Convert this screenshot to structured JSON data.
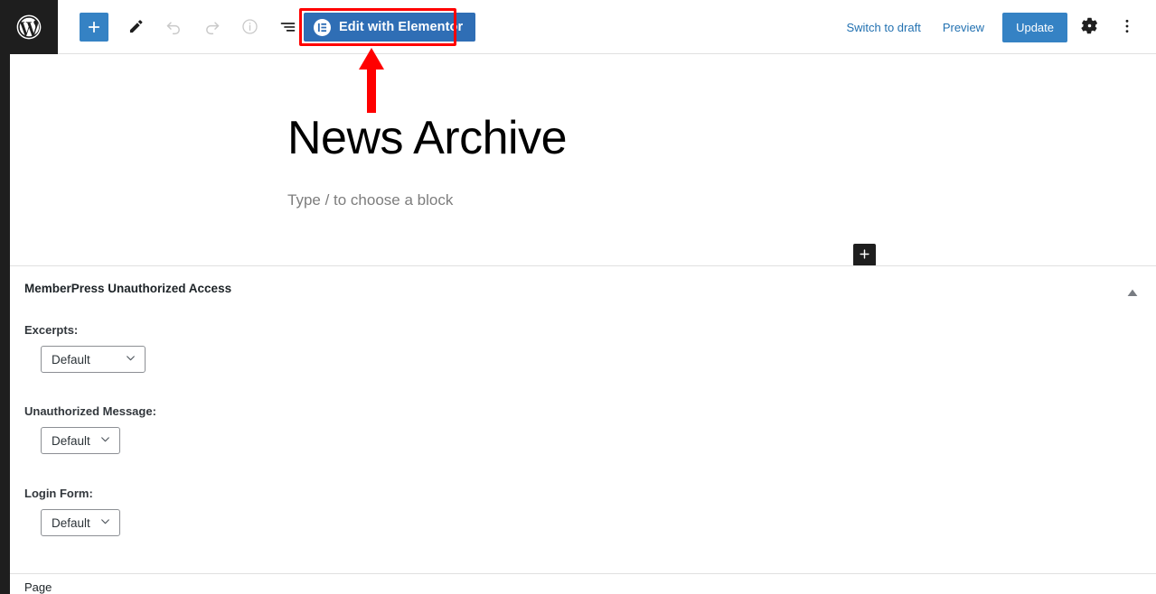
{
  "header": {
    "logo_icon": "wordpress-logo-icon",
    "left_tools": [
      {
        "name": "block-inserter-button",
        "icon": "plus-icon",
        "label": "Toggle block inserter",
        "state": "active"
      },
      {
        "name": "tools-edit-button",
        "icon": "pencil-icon",
        "label": "Tools",
        "state": "enabled"
      },
      {
        "name": "undo-button",
        "icon": "undo-icon",
        "label": "Undo",
        "state": "disabled"
      },
      {
        "name": "redo-button",
        "icon": "redo-icon",
        "label": "Redo",
        "state": "disabled"
      },
      {
        "name": "details-button",
        "icon": "info-icon",
        "label": "Details",
        "state": "disabled"
      },
      {
        "name": "list-view-button",
        "icon": "list-view-icon",
        "label": "List View",
        "state": "enabled"
      }
    ],
    "elementor": {
      "label": "Edit with Elementor",
      "icon": "elementor-logo-icon",
      "bg_color": "#2f6eb5",
      "highlight_color": "#ff0000"
    },
    "annotation": {
      "type": "arrow-up",
      "color": "#ff0000",
      "points_to": "Edit with Elementor"
    },
    "right_actions": {
      "switch_to_draft": "Switch to draft",
      "preview": "Preview",
      "update": "Update",
      "settings_icon": "gear-icon",
      "options_icon": "more-vertical-icon",
      "link_color": "#2271b1",
      "update_bg": "#3582c4"
    }
  },
  "canvas": {
    "post_title": "News Archive",
    "block_placeholder": "Type / to choose a block",
    "appender_icon": "plus-icon"
  },
  "metabox": {
    "title": "MemberPress Unauthorized Access",
    "toggle_icon": "chevron-up-icon",
    "fields": [
      {
        "label": "Excerpts:",
        "value": "Default",
        "width": "wide"
      },
      {
        "label": "Unauthorized Message:",
        "value": "Default",
        "width": "narrow"
      },
      {
        "label": "Login Form:",
        "value": "Default",
        "width": "narrow"
      }
    ]
  },
  "bottom": {
    "label": "Page"
  }
}
